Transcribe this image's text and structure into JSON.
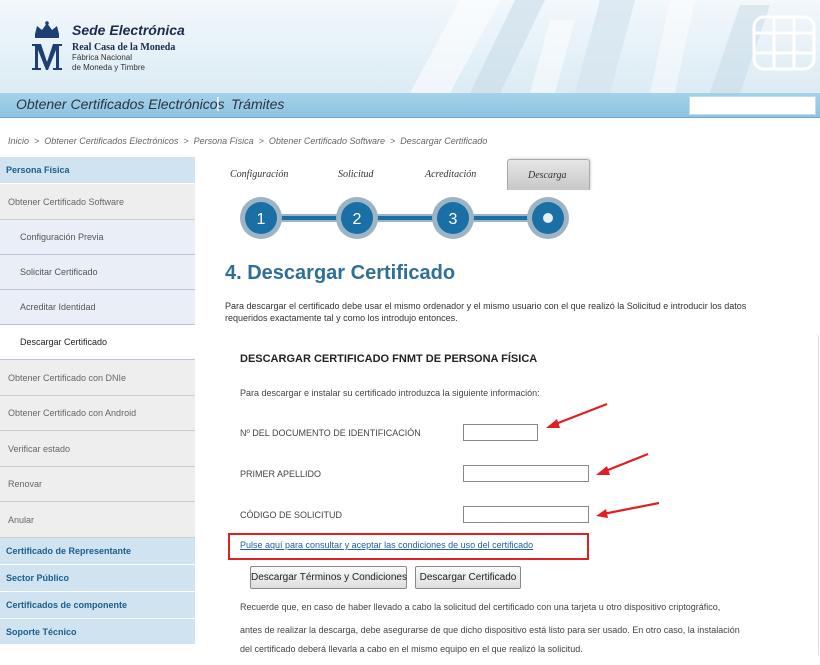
{
  "header": {
    "title": "Sede Electrónica",
    "org_line1": "Real Casa de la Moneda",
    "org_line2": "Fábrica Nacional",
    "org_line3": "de Moneda y Timbre",
    "logo_icon": "fnmt-crown-m-logo-icon",
    "decor_icon": "smartcard-chip-icon"
  },
  "topnav": {
    "items": [
      "Obtener Certificados Electrónicos",
      "Trámites"
    ],
    "separator": "|"
  },
  "breadcrumb": {
    "items": [
      "Inicio",
      "Obtener Certificados Electrónicos",
      "Persona Física",
      "Obtener Certificado Software",
      "Descargar Certificado"
    ],
    "separator": ">"
  },
  "sidebar": {
    "items": [
      {
        "label": "Persona Física",
        "level": "head"
      },
      {
        "label": "Obtener Certificado Software",
        "level": "sub"
      },
      {
        "label": "Configuración Previa",
        "level": "subsub"
      },
      {
        "label": "Solicitar Certificado",
        "level": "subsub"
      },
      {
        "label": "Acreditar Identidad",
        "level": "subsub"
      },
      {
        "label": "Descargar Certificado",
        "level": "subsub",
        "active": true
      },
      {
        "label": "Obtener Certificado con DNIe",
        "level": "sub"
      },
      {
        "label": "Obtener Certificado con Android",
        "level": "sub"
      },
      {
        "label": "Verificar estado",
        "level": "sub"
      },
      {
        "label": "Renovar",
        "level": "sub"
      },
      {
        "label": "Anular",
        "level": "sub"
      },
      {
        "label": "Certificado de Representante",
        "level": "head"
      },
      {
        "label": "Sector Público",
        "level": "head"
      },
      {
        "label": "Certificados de componente",
        "level": "head"
      },
      {
        "label": "Soporte Técnico",
        "level": "head"
      }
    ]
  },
  "steps": {
    "labels": [
      "Configuración",
      "Solicitud",
      "Acreditación",
      "Descarga"
    ],
    "numbers": [
      "1",
      "2",
      "3"
    ],
    "current": 4,
    "colors": {
      "circle": "#1a6fa5",
      "line": "#1a6fa5",
      "ring": "#9cb4c4"
    }
  },
  "main": {
    "title": "4. Descargar Certificado",
    "intro_line1": "Para descargar el certificado debe usar el mismo ordenador y el mismo usuario con el que realizó la Solicitud e introducir los datos",
    "intro_line2": "requeridos exactamente tal y como los introdujo entonces."
  },
  "form": {
    "title": "DESCARGAR CERTIFICADO FNMT DE PERSONA FÍSICA",
    "description": "Para descargar e instalar su certificado introduzca la siguiente información:",
    "fields": [
      {
        "label": "Nº DEL DOCUMENTO DE IDENTIFICACIÓN",
        "value": ""
      },
      {
        "label": "PRIMER APELLIDO",
        "value": ""
      },
      {
        "label": "CÓDIGO DE SOLICITUD",
        "value": ""
      }
    ],
    "conditions_link": "Pulse aquí para consultar y aceptar las condiciones de uso del certificado",
    "buttons": {
      "terms": "Descargar Términos y Condiciones",
      "download": "Descargar Certificado"
    },
    "notice": [
      "Recuerde que, en caso de haber llevado a cabo la solicitud del certificado con una tarjeta u otro dispositivo criptográfico,",
      "antes de realizar la descarga, debe asegurarse de que dicho dispositivo está listo para ser usado. En otro caso, la instalación",
      "del certificado deberá llevarla a cabo en el mismo equipo en el que realizó la solicitud."
    ]
  },
  "annotations": {
    "highlight_color": "#e02020",
    "arrow_icon": "red-arrow-icon"
  }
}
